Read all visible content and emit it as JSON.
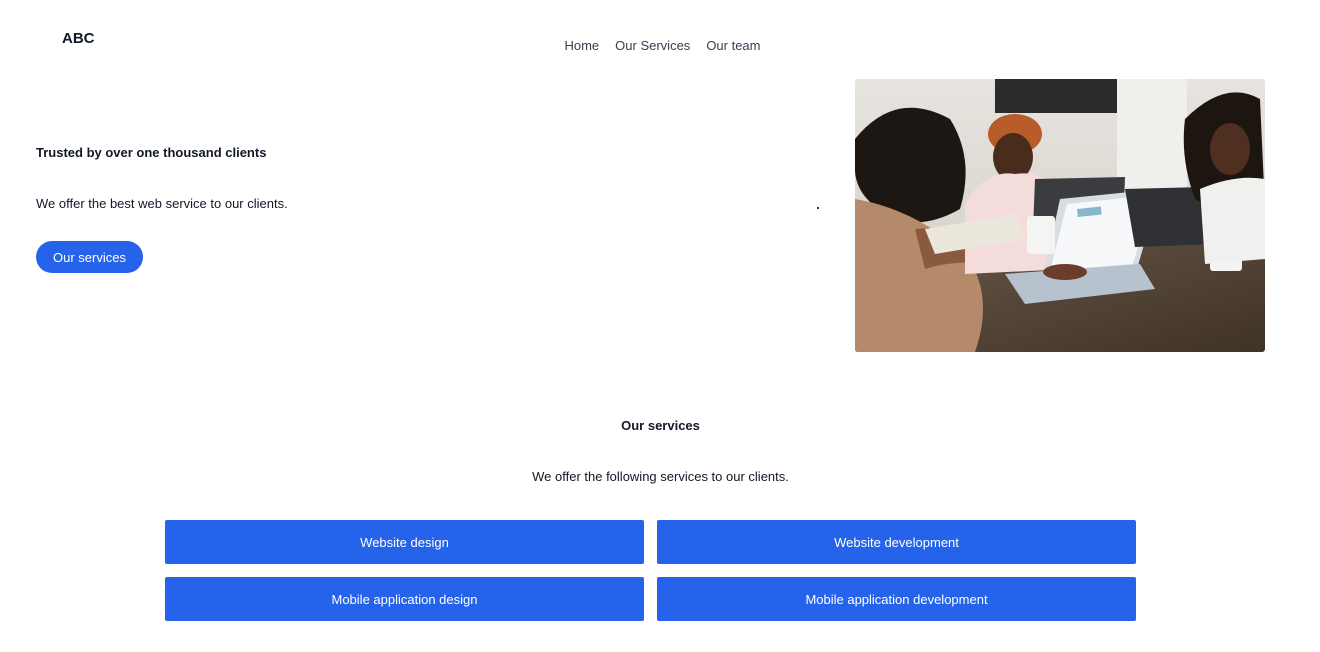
{
  "brand": {
    "logo_text": "ABC"
  },
  "nav": {
    "items": [
      {
        "label": "Home"
      },
      {
        "label": "Our Services"
      },
      {
        "label": "Our team"
      }
    ]
  },
  "hero": {
    "title": "Trusted by over one thousand clients",
    "subtitle": "We offer the best web service to our clients.",
    "cta_label": "Our services",
    "image_subject": "team-meeting-photo"
  },
  "services": {
    "title": "Our services",
    "subtitle": "We offer the following services to our clients.",
    "items": [
      {
        "label": "Website design"
      },
      {
        "label": "Website development"
      },
      {
        "label": "Mobile application design"
      },
      {
        "label": "Mobile application development"
      }
    ]
  },
  "colors": {
    "accent": "#2563eb",
    "text": "#111827",
    "nav_text": "#374151",
    "background": "#ffffff"
  }
}
